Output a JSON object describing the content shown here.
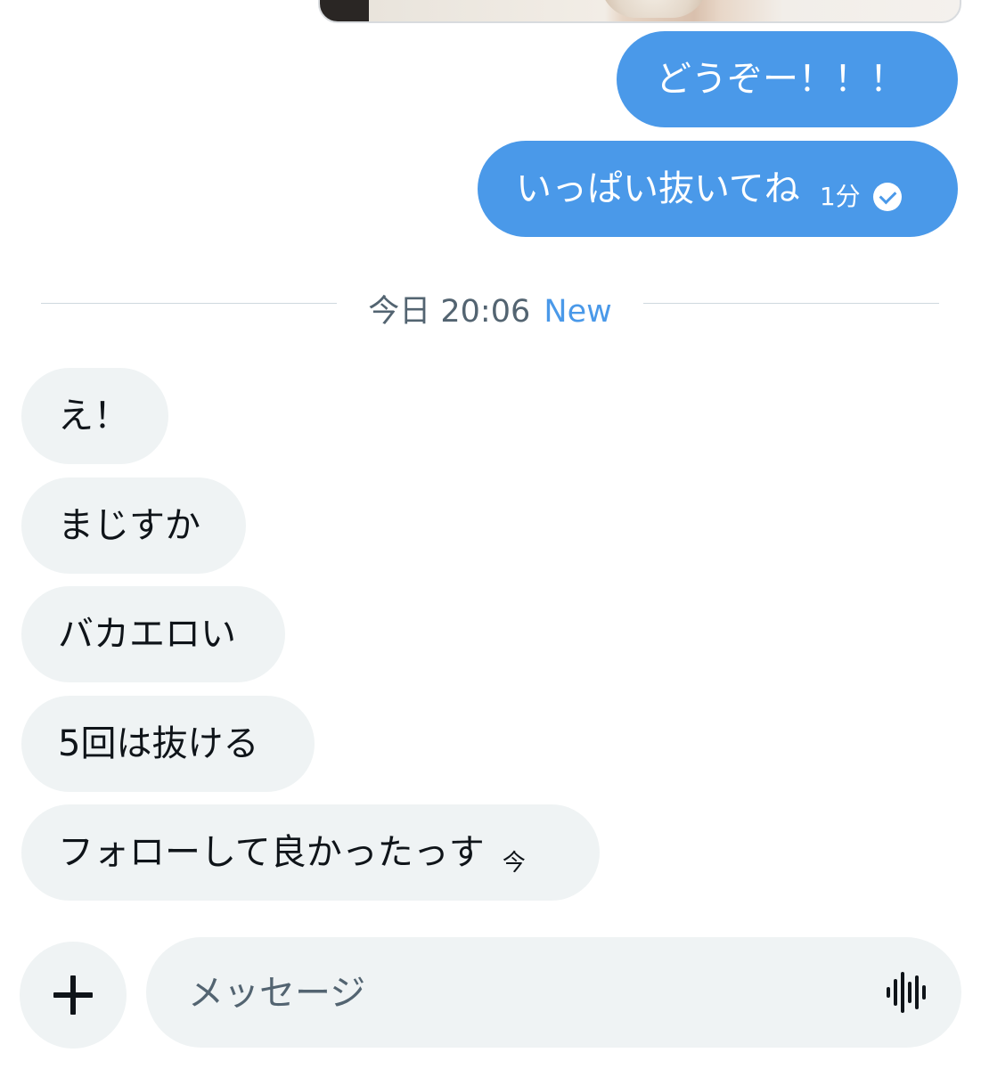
{
  "colors": {
    "outgoing_bubble": "#4a99e9",
    "incoming_bubble": "#eff3f4",
    "accent": "#4a99e9",
    "divider_text": "#536471"
  },
  "top_media": {
    "icon": "image-attachment"
  },
  "outgoing_messages": [
    {
      "text": "どうぞー！！！"
    },
    {
      "text": "いっぱい抜いてね",
      "time": "1分",
      "status_icon": "read-check-icon"
    }
  ],
  "divider": {
    "time": "今日 20:06",
    "badge": "New"
  },
  "incoming_messages": [
    {
      "text": "え！"
    },
    {
      "text": "まじすか"
    },
    {
      "text": "バカエロい"
    },
    {
      "text": "5回は抜ける"
    },
    {
      "text": "フォローして良かったっす",
      "time": "今"
    }
  ],
  "composer": {
    "add_icon": "plus-icon",
    "placeholder": "メッセージ",
    "voice_icon": "voice-waveform-icon"
  }
}
